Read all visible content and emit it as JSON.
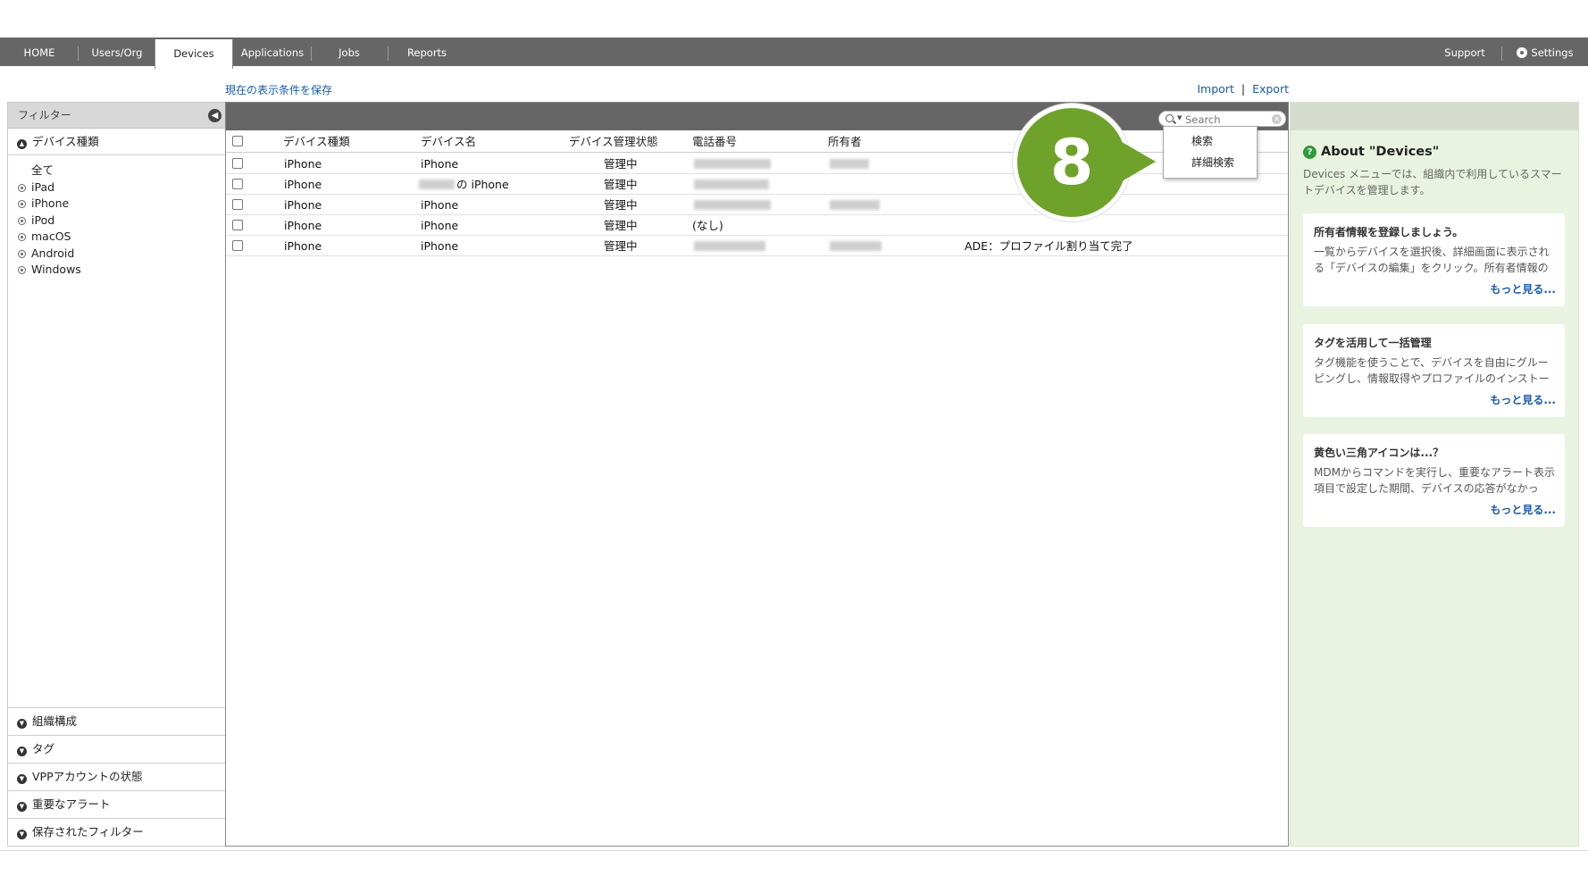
{
  "nav": {
    "home": "HOME",
    "users": "Users/Org",
    "devices": "Devices",
    "applications": "Applications",
    "jobs": "Jobs",
    "reports": "Reports",
    "support": "Support",
    "settings": "Settings"
  },
  "toolbar": {
    "save_filter": "現在の表示条件を保存",
    "import": "Import",
    "export": "Export",
    "separator": "|"
  },
  "filter": {
    "header": "フィルター",
    "device_type_title": "デバイス種類",
    "device_types": [
      "全て",
      "iPad",
      "iPhone",
      "iPod",
      "macOS",
      "Android",
      "Windows"
    ],
    "sections": [
      "組織構成",
      "タグ",
      "VPPアカウントの状態",
      "重要なアラート",
      "保存されたフィルター"
    ]
  },
  "search": {
    "placeholder": "Search",
    "menu": [
      "検索",
      "詳細検索"
    ]
  },
  "callout": {
    "number": "8"
  },
  "table": {
    "columns": [
      "デバイス種類",
      "デバイス名",
      "デバイス管理状態",
      "電話番号",
      "所有者"
    ],
    "rows": [
      {
        "type": "iPhone",
        "name": "iPhone",
        "status": "管理中",
        "phone": "",
        "owner": "",
        "note": ""
      },
      {
        "type": "iPhone",
        "name": "の iPhone",
        "status": "管理中",
        "phone": "",
        "owner": "",
        "note": ""
      },
      {
        "type": "iPhone",
        "name": "iPhone",
        "status": "管理中",
        "phone": "",
        "owner": "",
        "note": ""
      },
      {
        "type": "iPhone",
        "name": "iPhone",
        "status": "管理中",
        "phone": "(なし)",
        "owner": "",
        "note": ""
      },
      {
        "type": "iPhone",
        "name": "iPhone",
        "status": "管理中",
        "phone": "",
        "owner": "",
        "note": "ADE：プロファイル割り当て完了"
      }
    ]
  },
  "about": {
    "title": "About \"Devices\"",
    "description": "Devices メニューでは、組織内で利用しているスマートデバイスを管理します。",
    "tips": [
      {
        "title": "所有者情報を登録しましょう。",
        "body": "一覧からデバイスを選択後、詳細画面に表示される「デバイスの編集」をクリック。所有者情報の",
        "more": "もっと見る..."
      },
      {
        "title": "タグを活用して一括管理",
        "body": "タグ機能を使うことで、デバイスを自由にグルーピングし、情報取得やプロファイルのインストー",
        "more": "もっと見る..."
      },
      {
        "title": "黄色い三角アイコンは...？",
        "body": "MDMからコマンドを実行し、重要なアラート表示項目で設定した期間、デバイスの応答がなかっ",
        "more": "もっと見る..."
      }
    ]
  },
  "colors": {
    "nav_bg": "#666666",
    "link": "#1a5aa8",
    "callout": "#6fa22a",
    "about_bg": "#eaf3e0",
    "help_icon": "#2e9a3a"
  },
  "icons": [
    "gear-icon",
    "collapse-arrow-icon",
    "chevron-up-icon",
    "chevron-down-icon",
    "search-icon",
    "clear-icon",
    "help-icon"
  ]
}
